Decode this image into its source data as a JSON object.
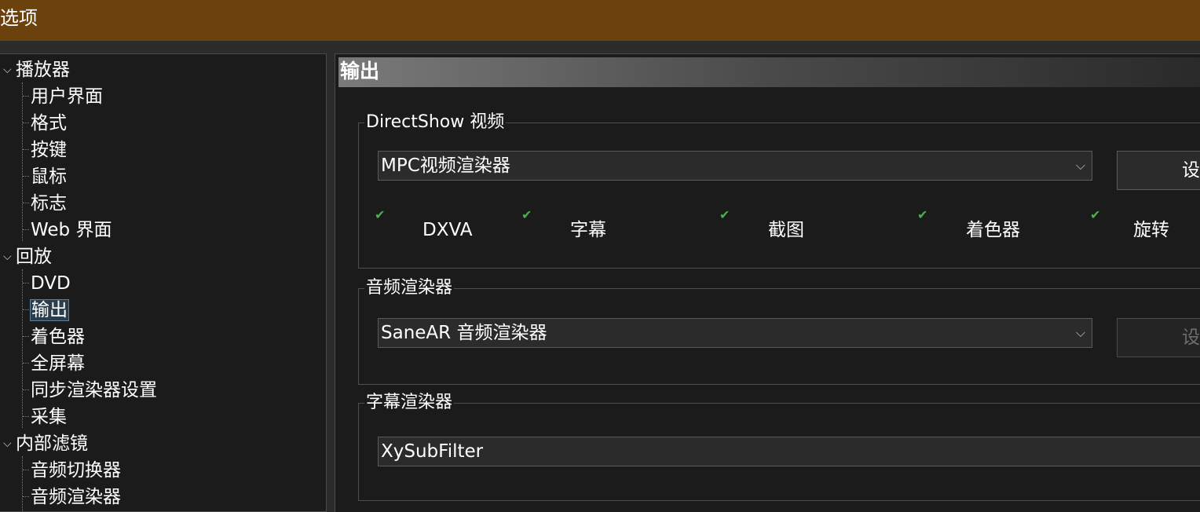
{
  "window": {
    "title": "选项"
  },
  "tree": {
    "items": [
      {
        "label": "播放器",
        "level": 0,
        "expanded": true
      },
      {
        "label": "用户界面",
        "level": 1
      },
      {
        "label": "格式",
        "level": 1
      },
      {
        "label": "按键",
        "level": 1
      },
      {
        "label": "鼠标",
        "level": 1
      },
      {
        "label": "标志",
        "level": 1
      },
      {
        "label": "Web 界面",
        "level": 1
      },
      {
        "label": "回放",
        "level": 0,
        "expanded": true
      },
      {
        "label": "DVD",
        "level": 1
      },
      {
        "label": "输出",
        "level": 1,
        "selected": true
      },
      {
        "label": "着色器",
        "level": 1
      },
      {
        "label": "全屏幕",
        "level": 1
      },
      {
        "label": "同步渲染器设置",
        "level": 1
      },
      {
        "label": "采集",
        "level": 1
      },
      {
        "label": "内部滤镜",
        "level": 0,
        "expanded": true
      },
      {
        "label": "音频切换器",
        "level": 1
      },
      {
        "label": "音频渲染器",
        "level": 1
      }
    ]
  },
  "page": {
    "header": "输出"
  },
  "directshow_video": {
    "legend": "DirectShow 视频",
    "renderer": "MPC视频渲染器",
    "settings_button": "设",
    "features": [
      {
        "label": "DXVA",
        "checked": true
      },
      {
        "label": "字幕",
        "checked": true
      },
      {
        "label": "截图",
        "checked": true
      },
      {
        "label": "着色器",
        "checked": true
      },
      {
        "label": "旋转",
        "checked": true
      }
    ]
  },
  "audio_renderer": {
    "legend": "音频渲染器",
    "renderer": "SaneAR 音频渲染器",
    "settings_button": "设",
    "settings_enabled": false
  },
  "subtitle_renderer": {
    "legend": "字幕渲染器",
    "renderer": "XySubFilter"
  },
  "colors": {
    "titlebar": "#6b410e",
    "background": "#1b1b1b",
    "check": "#4caf50",
    "selection": "#2a3d4d"
  }
}
